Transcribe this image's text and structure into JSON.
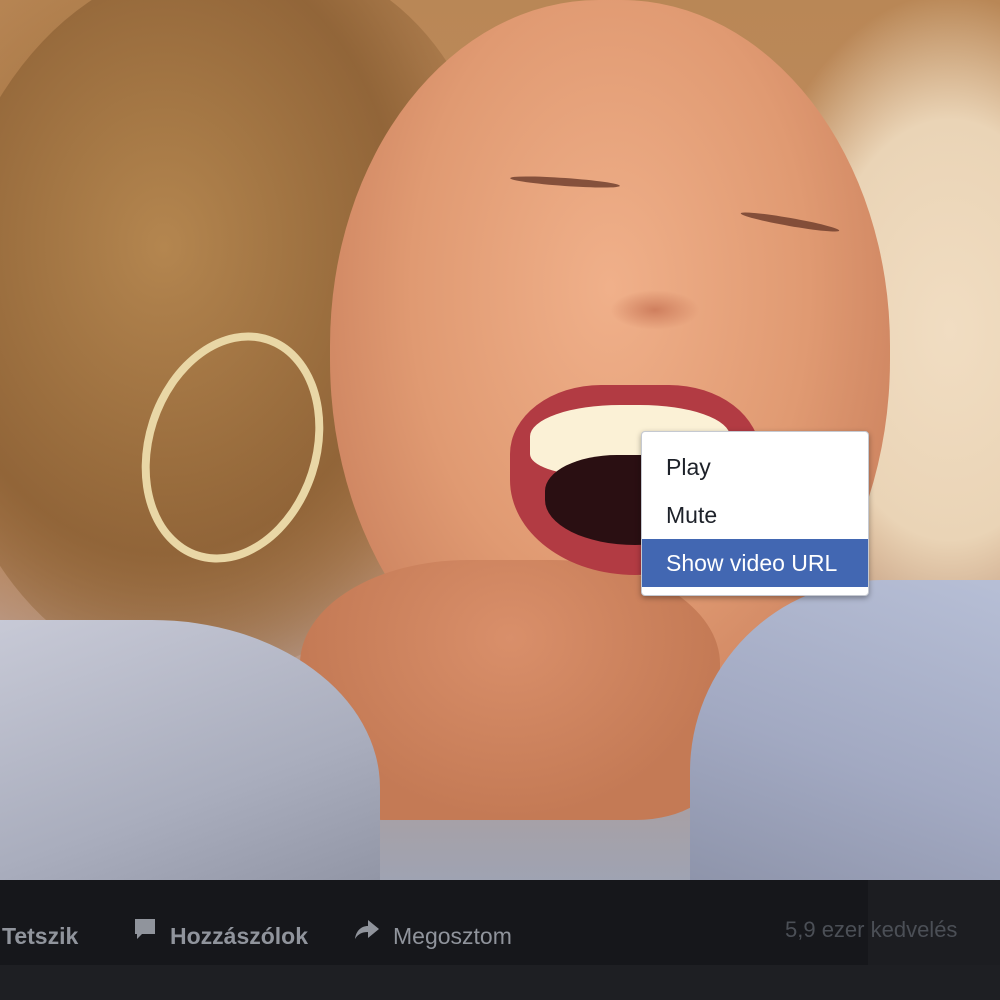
{
  "context_menu": {
    "items": [
      {
        "label": "Play",
        "selected": false
      },
      {
        "label": "Mute",
        "selected": false
      },
      {
        "label": "Show video URL",
        "selected": true
      }
    ],
    "highlight_color": "#4267b2"
  },
  "action_bar": {
    "like_label": "Tetszik",
    "comment_label": "Hozzászólok",
    "share_label": "Megosztom",
    "likes_count": "5,9 ezer kedvelés",
    "icons": {
      "comment": "comment-bubble-icon",
      "share": "share-arrow-icon"
    }
  }
}
